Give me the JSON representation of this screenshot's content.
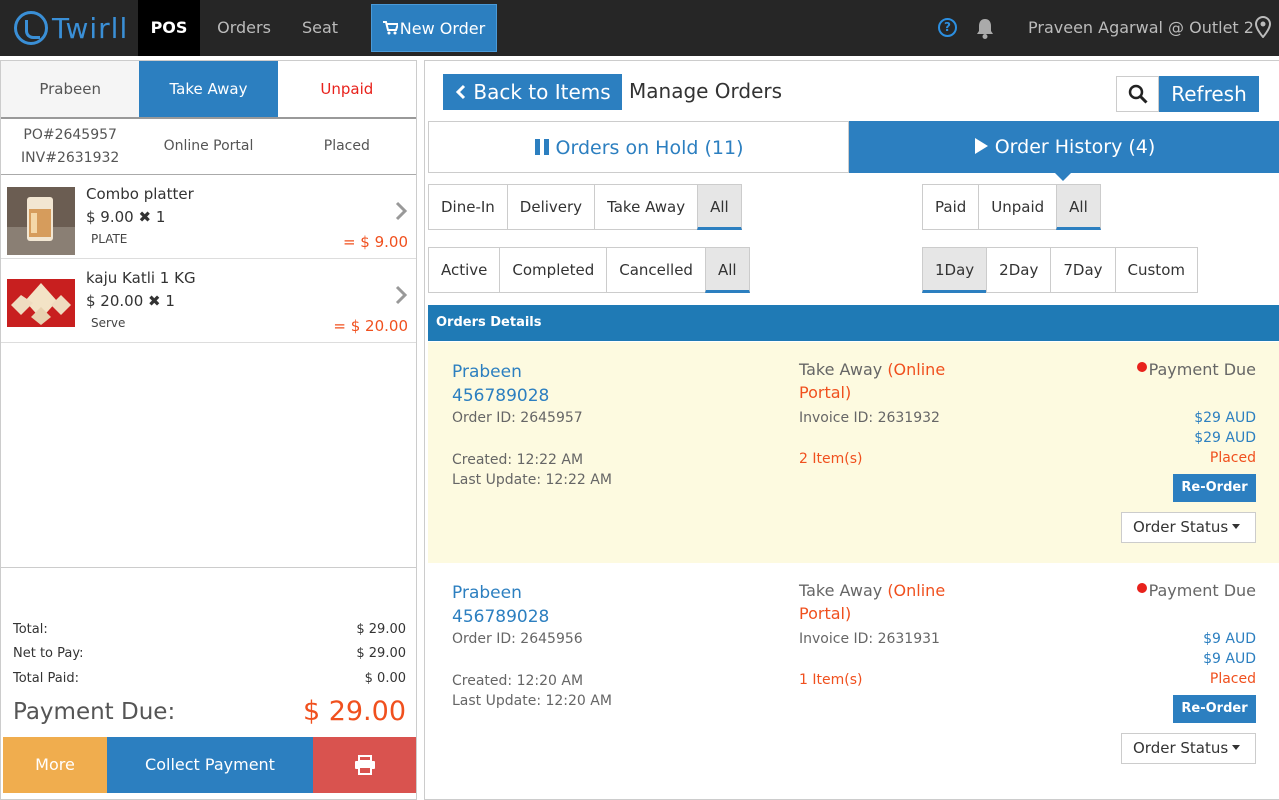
{
  "nav": {
    "logo_text": "Twirll",
    "pos": "POS",
    "orders": "Orders",
    "seat": "Seat",
    "new_order": "New Order",
    "help_glyph": "?",
    "user": "Praveen Agarwal @ Outlet 2"
  },
  "left": {
    "tabs": [
      "Prabeen",
      "Take Away",
      "Unpaid"
    ],
    "meta": {
      "po": "PO#2645957",
      "inv": "INV#2631932",
      "channel": "Online Portal",
      "status": "Placed"
    },
    "items": [
      {
        "name": "Combo platter",
        "price": "$ 9.00",
        "qty": "1",
        "note": "PLATE",
        "total": "= $ 9.00"
      },
      {
        "name": "kaju Katli 1 KG",
        "price": "$ 20.00",
        "qty": "1",
        "note": "Serve",
        "total": "= $ 20.00"
      }
    ],
    "summary": {
      "total_label": "Total:",
      "total_val": "$ 29.00",
      "net_label": "Net to Pay:",
      "net_val": "$ 29.00",
      "paid_label": "Total Paid:",
      "paid_val": "$ 0.00",
      "due_label": "Payment Due:",
      "due_val": "$ 29.00"
    },
    "actions": {
      "more": "More",
      "collect": "Collect Payment",
      "print_icon": "print-icon"
    }
  },
  "right": {
    "back": "Back to Items",
    "title": "Manage Orders",
    "refresh": "Refresh",
    "tab_hold": "Orders on Hold (11)",
    "tab_history": "Order History (4)",
    "filters": {
      "type": [
        "Dine-In",
        "Delivery",
        "Take Away",
        "All"
      ],
      "payment": [
        "Paid",
        "Unpaid",
        "All"
      ],
      "status": [
        "Active",
        "Completed",
        "Cancelled",
        "All"
      ],
      "period": [
        "1Day",
        "2Day",
        "7Day",
        "Custom"
      ]
    },
    "details_header": "Orders Details",
    "orders": [
      {
        "name": "Prabeen",
        "phone": "456789028",
        "order_id": "Order ID: 2645957",
        "created": "Created: 12:22 AM",
        "updated": "Last Update: 12:22 AM",
        "type": "Take Away",
        "source": "(Online Portal)",
        "invoice": "Invoice ID: 2631932",
        "items": "2 Item(s)",
        "payment": "Payment Due",
        "amount1": "$29 AUD",
        "amount2": "$29 AUD",
        "status": "Placed",
        "reorder": "Re-Order",
        "order_status": "Order Status"
      },
      {
        "name": "Prabeen",
        "phone": "456789028",
        "order_id": "Order ID: 2645956",
        "created": "Created: 12:20 AM",
        "updated": "Last Update: 12:20 AM",
        "type": "Take Away",
        "source": "(Online Portal)",
        "invoice": "Invoice ID: 2631931",
        "items": "1 Item(s)",
        "payment": "Payment Due",
        "amount1": "$9 AUD",
        "amount2": "$9 AUD",
        "status": "Placed",
        "reorder": "Re-Order",
        "order_status": "Order Status"
      }
    ]
  },
  "colors": {
    "primary": "#2c7fc0",
    "accent_orange": "#f0501e",
    "warning": "#f0ad4e",
    "danger": "#d9534f",
    "highlight_row": "#fdfae0"
  }
}
